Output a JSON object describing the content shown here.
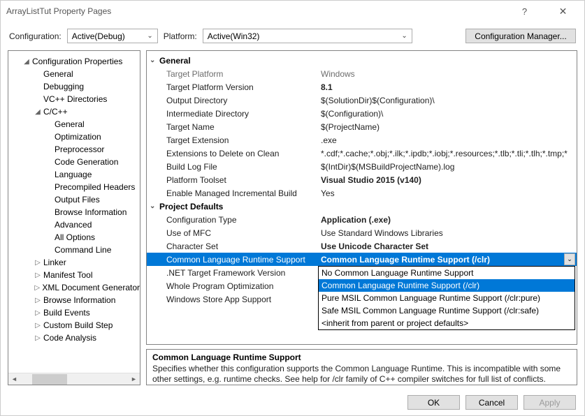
{
  "titlebar": {
    "title": "ArrayListTut Property Pages",
    "help": "?",
    "close": "✕"
  },
  "toolbar": {
    "config_label": "Configuration:",
    "config_value": "Active(Debug)",
    "platform_label": "Platform:",
    "platform_value": "Active(Win32)",
    "cfg_mgr_label": "Configuration Manager..."
  },
  "tree": {
    "root": "Configuration Properties",
    "items": [
      {
        "label": "General",
        "indent": 2
      },
      {
        "label": "Debugging",
        "indent": 2
      },
      {
        "label": "VC++ Directories",
        "indent": 2
      },
      {
        "label": "C/C++",
        "indent": 2,
        "exp": true,
        "children": [
          {
            "label": "General",
            "indent": 3
          },
          {
            "label": "Optimization",
            "indent": 3
          },
          {
            "label": "Preprocessor",
            "indent": 3
          },
          {
            "label": "Code Generation",
            "indent": 3
          },
          {
            "label": "Language",
            "indent": 3
          },
          {
            "label": "Precompiled Headers",
            "indent": 3
          },
          {
            "label": "Output Files",
            "indent": 3
          },
          {
            "label": "Browse Information",
            "indent": 3
          },
          {
            "label": "Advanced",
            "indent": 3
          },
          {
            "label": "All Options",
            "indent": 3
          },
          {
            "label": "Command Line",
            "indent": 3
          }
        ]
      },
      {
        "label": "Linker",
        "indent": 2,
        "exp": false
      },
      {
        "label": "Manifest Tool",
        "indent": 2,
        "exp": false
      },
      {
        "label": "XML Document Generator",
        "indent": 2,
        "exp": false
      },
      {
        "label": "Browse Information",
        "indent": 2,
        "exp": false
      },
      {
        "label": "Build Events",
        "indent": 2,
        "exp": false
      },
      {
        "label": "Custom Build Step",
        "indent": 2,
        "exp": false
      },
      {
        "label": "Code Analysis",
        "indent": 2,
        "exp": false
      }
    ]
  },
  "grid": {
    "cat1": "General",
    "cat2": "Project Defaults",
    "props1": [
      {
        "name": "Target Platform",
        "val": "Windows",
        "dim": true
      },
      {
        "name": "Target Platform Version",
        "val": "8.1",
        "bold": true
      },
      {
        "name": "Output Directory",
        "val": "$(SolutionDir)$(Configuration)\\"
      },
      {
        "name": "Intermediate Directory",
        "val": "$(Configuration)\\"
      },
      {
        "name": "Target Name",
        "val": "$(ProjectName)"
      },
      {
        "name": "Target Extension",
        "val": ".exe"
      },
      {
        "name": "Extensions to Delete on Clean",
        "val": "*.cdf;*.cache;*.obj;*.ilk;*.ipdb;*.iobj;*.resources;*.tlb;*.tli;*.tlh;*.tmp;*"
      },
      {
        "name": "Build Log File",
        "val": "$(IntDir)$(MSBuildProjectName).log"
      },
      {
        "name": "Platform Toolset",
        "val": "Visual Studio 2015 (v140)",
        "bold": true
      },
      {
        "name": "Enable Managed Incremental Build",
        "val": "Yes"
      }
    ],
    "props2": [
      {
        "name": "Configuration Type",
        "val": "Application (.exe)",
        "bold": true
      },
      {
        "name": "Use of MFC",
        "val": "Use Standard Windows Libraries"
      },
      {
        "name": "Character Set",
        "val": "Use Unicode Character Set",
        "bold": true
      },
      {
        "name": "Common Language Runtime Support",
        "val": "Common Language Runtime Support (/clr)",
        "selected": true
      },
      {
        "name": ".NET Target Framework Version",
        "val": ""
      },
      {
        "name": "Whole Program Optimization",
        "val": ""
      },
      {
        "name": "Windows Store App Support",
        "val": ""
      }
    ],
    "dropdown": {
      "options": [
        "No Common Language Runtime Support",
        "Common Language Runtime Support (/clr)",
        "Pure MSIL Common Language Runtime Support (/clr:pure)",
        "Safe MSIL Common Language Runtime Support (/clr:safe)",
        "<inherit from parent or project defaults>"
      ],
      "selected_index": 1
    }
  },
  "desc": {
    "title": "Common Language Runtime Support",
    "text": "Specifies whether this configuration supports the Common Language Runtime. This is incompatible with some other settings, e.g. runtime checks. See help for /clr family of C++ compiler switches for full list of conflicts."
  },
  "footer": {
    "ok": "OK",
    "cancel": "Cancel",
    "apply": "Apply"
  }
}
